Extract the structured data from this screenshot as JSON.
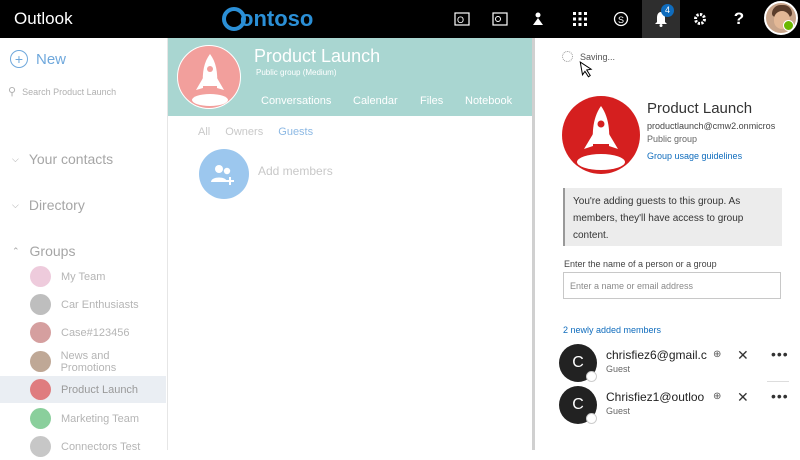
{
  "topbar": {
    "app_title": "Outlook",
    "brand": "ontoso",
    "icons": [
      "outlook-app-icon",
      "outlook-icon",
      "teams-icon",
      "app-launcher-icon",
      "skype-icon",
      "bell-icon",
      "gear-icon",
      "help-icon"
    ],
    "notification_count": "4"
  },
  "leftnav": {
    "new_label": "New",
    "search_placeholder": "Search Product Launch",
    "sections": [
      "Your contacts",
      "Directory",
      "Groups"
    ],
    "groups": [
      {
        "label": "My Team",
        "color": "#e0a0c0"
      },
      {
        "label": "Car Enthusiasts",
        "color": "#888888"
      },
      {
        "label": "Case#123456",
        "color": "#b35050"
      },
      {
        "label": "News and Promotions",
        "color": "#8a6040"
      },
      {
        "label": "Product Launch",
        "color": "#d51f1f"
      },
      {
        "label": "Marketing Team",
        "color": "#2aa84a"
      },
      {
        "label": "Connectors Test",
        "color": "#999999"
      }
    ]
  },
  "group": {
    "title": "Product Launch",
    "subtitle": "Public group  (Medium)",
    "tabs": [
      "Conversations",
      "Calendar",
      "Files",
      "Notebook"
    ],
    "member_tabs": [
      "All",
      "Owners",
      "Guests"
    ],
    "add_members": "Add members"
  },
  "panel": {
    "status": "Saving...",
    "title": "Product Launch",
    "email": "productlaunch@cmw2.onmicros",
    "type": "Public group",
    "link": "Group usage guidelines",
    "note": "You're adding guests to this group. As members, they'll have access to group content.",
    "field_label": "Enter the name of a person or a group",
    "field_placeholder": "Enter a name or email address",
    "added_header": "2 newly added members",
    "members": [
      {
        "initial": "C",
        "name": "chrisfiez6@gmail.c",
        "role": "Guest"
      },
      {
        "initial": "C",
        "name": "Chrisfiez1@outloo",
        "role": "Guest"
      }
    ]
  }
}
